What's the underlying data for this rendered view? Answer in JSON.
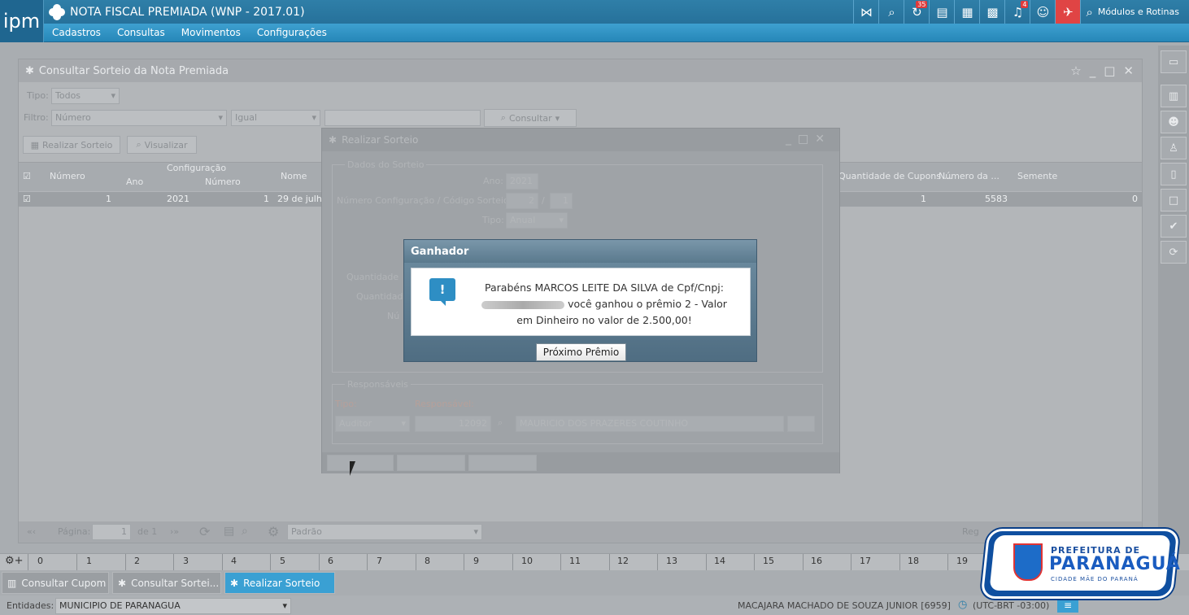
{
  "header": {
    "logo": "ipm",
    "app_title": "NOTA FISCAL PREMIADA (WNP - 2017.01)",
    "menu": [
      "Cadastros",
      "Consultas",
      "Movimentos",
      "Configurações"
    ],
    "badges": {
      "sync": "35",
      "bell": "4"
    },
    "modules_label": "Módulos e Rotinas"
  },
  "main_window": {
    "title": "Consultar Sorteio da Nota Premiada",
    "tipo_label": "Tipo:",
    "tipo_value": "Todos",
    "filtro_label": "Filtro:",
    "filtro_value": "Número",
    "operador_value": "Igual",
    "consultar_label": "Consultar",
    "realizar_btn": "Realizar Sorteio",
    "visualizar_btn": "Visualizar",
    "grid": {
      "headers": {
        "numero": "Número",
        "configuracao": "Configuração",
        "ano": "Ano",
        "numero_sub": "Número",
        "nome": "Nome",
        "qtd_cupons": "Quantidade de Cupons ...",
        "numero_da": "Número da ...",
        "semente": "Semente"
      },
      "row": {
        "numero": "1",
        "ano": "2021",
        "numero_config": "1",
        "nome": "29 de julh",
        "qtd_cupons": "1",
        "numero_da": "5583",
        "semente": "0"
      }
    },
    "pager": {
      "pagina_label": "Página:",
      "pagina_value": "1",
      "de_label": "de 1",
      "layout_value": "Padrão",
      "registros_label": "Reg"
    }
  },
  "realizar_window": {
    "title": "Realizar Sorteio",
    "dados_legend": "Dados do Sorteio",
    "ano_label": "Ano:",
    "ano_value": "2021",
    "config_label": "Número Configuração / Código Sorteio:",
    "config_value_1": "2",
    "config_sep": "/",
    "config_value_2": "1",
    "tipo_label": "Tipo:",
    "tipo_value": "Anual",
    "quantidade_label_1": "Quantidade",
    "quantidade_label_2": "Quantidad",
    "numero_label": "Nú",
    "resp_legend": "Responsáveis",
    "resp_tipo_label": "Tipo:",
    "resp_responsavel_label": "Responsável:",
    "resp_tipo_value": "Auditor",
    "resp_codigo_value": "12092",
    "resp_nome_value": "MAURICIO DOS PRAZERES COUTINHO"
  },
  "dialog": {
    "title": "Ganhador",
    "message_line1": "Parabéns MARCOS LEITE DA SILVA de Cpf/Cnpj:",
    "message_line2": "você ganhou o prêmio 2 - Valor",
    "message_line3": "em Dinheiro no valor de 2.500,00!",
    "button": "Próximo Prêmio"
  },
  "numbar": {
    "numbers": [
      "0",
      "1",
      "2",
      "3",
      "4",
      "5",
      "6",
      "7",
      "8",
      "9",
      "10",
      "11",
      "12",
      "13",
      "14",
      "15",
      "16",
      "17",
      "18",
      "19"
    ]
  },
  "tasks": [
    {
      "label": "Consultar Cupom",
      "active": false
    },
    {
      "label": "Consultar Sortei...",
      "active": false
    },
    {
      "label": "Realizar Sorteio",
      "active": true
    }
  ],
  "status": {
    "entidades_label": "Entidades:",
    "entidade_value": "MUNICIPIO DE PARANAGUA",
    "user": "MACAJARA MACHADO DE SOUZA JUNIOR [6959]",
    "timezone": "(UTC-BRT -03:00)"
  },
  "prefeitura": {
    "line1": "PREFEITURA DE",
    "line2": "PARANAGUÁ",
    "line3": "CIDADE MÃE DO PARANÁ"
  }
}
